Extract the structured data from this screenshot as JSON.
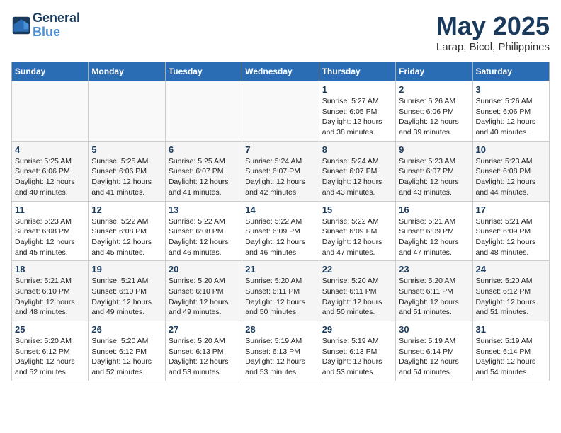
{
  "header": {
    "logo_line1": "General",
    "logo_line2": "Blue",
    "month": "May 2025",
    "location": "Larap, Bicol, Philippines"
  },
  "weekdays": [
    "Sunday",
    "Monday",
    "Tuesday",
    "Wednesday",
    "Thursday",
    "Friday",
    "Saturday"
  ],
  "weeks": [
    [
      {
        "day": "",
        "info": ""
      },
      {
        "day": "",
        "info": ""
      },
      {
        "day": "",
        "info": ""
      },
      {
        "day": "",
        "info": ""
      },
      {
        "day": "1",
        "info": "Sunrise: 5:27 AM\nSunset: 6:05 PM\nDaylight: 12 hours\nand 38 minutes."
      },
      {
        "day": "2",
        "info": "Sunrise: 5:26 AM\nSunset: 6:06 PM\nDaylight: 12 hours\nand 39 minutes."
      },
      {
        "day": "3",
        "info": "Sunrise: 5:26 AM\nSunset: 6:06 PM\nDaylight: 12 hours\nand 40 minutes."
      }
    ],
    [
      {
        "day": "4",
        "info": "Sunrise: 5:25 AM\nSunset: 6:06 PM\nDaylight: 12 hours\nand 40 minutes."
      },
      {
        "day": "5",
        "info": "Sunrise: 5:25 AM\nSunset: 6:06 PM\nDaylight: 12 hours\nand 41 minutes."
      },
      {
        "day": "6",
        "info": "Sunrise: 5:25 AM\nSunset: 6:07 PM\nDaylight: 12 hours\nand 41 minutes."
      },
      {
        "day": "7",
        "info": "Sunrise: 5:24 AM\nSunset: 6:07 PM\nDaylight: 12 hours\nand 42 minutes."
      },
      {
        "day": "8",
        "info": "Sunrise: 5:24 AM\nSunset: 6:07 PM\nDaylight: 12 hours\nand 43 minutes."
      },
      {
        "day": "9",
        "info": "Sunrise: 5:23 AM\nSunset: 6:07 PM\nDaylight: 12 hours\nand 43 minutes."
      },
      {
        "day": "10",
        "info": "Sunrise: 5:23 AM\nSunset: 6:08 PM\nDaylight: 12 hours\nand 44 minutes."
      }
    ],
    [
      {
        "day": "11",
        "info": "Sunrise: 5:23 AM\nSunset: 6:08 PM\nDaylight: 12 hours\nand 45 minutes."
      },
      {
        "day": "12",
        "info": "Sunrise: 5:22 AM\nSunset: 6:08 PM\nDaylight: 12 hours\nand 45 minutes."
      },
      {
        "day": "13",
        "info": "Sunrise: 5:22 AM\nSunset: 6:08 PM\nDaylight: 12 hours\nand 46 minutes."
      },
      {
        "day": "14",
        "info": "Sunrise: 5:22 AM\nSunset: 6:09 PM\nDaylight: 12 hours\nand 46 minutes."
      },
      {
        "day": "15",
        "info": "Sunrise: 5:22 AM\nSunset: 6:09 PM\nDaylight: 12 hours\nand 47 minutes."
      },
      {
        "day": "16",
        "info": "Sunrise: 5:21 AM\nSunset: 6:09 PM\nDaylight: 12 hours\nand 47 minutes."
      },
      {
        "day": "17",
        "info": "Sunrise: 5:21 AM\nSunset: 6:09 PM\nDaylight: 12 hours\nand 48 minutes."
      }
    ],
    [
      {
        "day": "18",
        "info": "Sunrise: 5:21 AM\nSunset: 6:10 PM\nDaylight: 12 hours\nand 48 minutes."
      },
      {
        "day": "19",
        "info": "Sunrise: 5:21 AM\nSunset: 6:10 PM\nDaylight: 12 hours\nand 49 minutes."
      },
      {
        "day": "20",
        "info": "Sunrise: 5:20 AM\nSunset: 6:10 PM\nDaylight: 12 hours\nand 49 minutes."
      },
      {
        "day": "21",
        "info": "Sunrise: 5:20 AM\nSunset: 6:11 PM\nDaylight: 12 hours\nand 50 minutes."
      },
      {
        "day": "22",
        "info": "Sunrise: 5:20 AM\nSunset: 6:11 PM\nDaylight: 12 hours\nand 50 minutes."
      },
      {
        "day": "23",
        "info": "Sunrise: 5:20 AM\nSunset: 6:11 PM\nDaylight: 12 hours\nand 51 minutes."
      },
      {
        "day": "24",
        "info": "Sunrise: 5:20 AM\nSunset: 6:12 PM\nDaylight: 12 hours\nand 51 minutes."
      }
    ],
    [
      {
        "day": "25",
        "info": "Sunrise: 5:20 AM\nSunset: 6:12 PM\nDaylight: 12 hours\nand 52 minutes."
      },
      {
        "day": "26",
        "info": "Sunrise: 5:20 AM\nSunset: 6:12 PM\nDaylight: 12 hours\nand 52 minutes."
      },
      {
        "day": "27",
        "info": "Sunrise: 5:20 AM\nSunset: 6:13 PM\nDaylight: 12 hours\nand 53 minutes."
      },
      {
        "day": "28",
        "info": "Sunrise: 5:19 AM\nSunset: 6:13 PM\nDaylight: 12 hours\nand 53 minutes."
      },
      {
        "day": "29",
        "info": "Sunrise: 5:19 AM\nSunset: 6:13 PM\nDaylight: 12 hours\nand 53 minutes."
      },
      {
        "day": "30",
        "info": "Sunrise: 5:19 AM\nSunset: 6:14 PM\nDaylight: 12 hours\nand 54 minutes."
      },
      {
        "day": "31",
        "info": "Sunrise: 5:19 AM\nSunset: 6:14 PM\nDaylight: 12 hours\nand 54 minutes."
      }
    ]
  ]
}
